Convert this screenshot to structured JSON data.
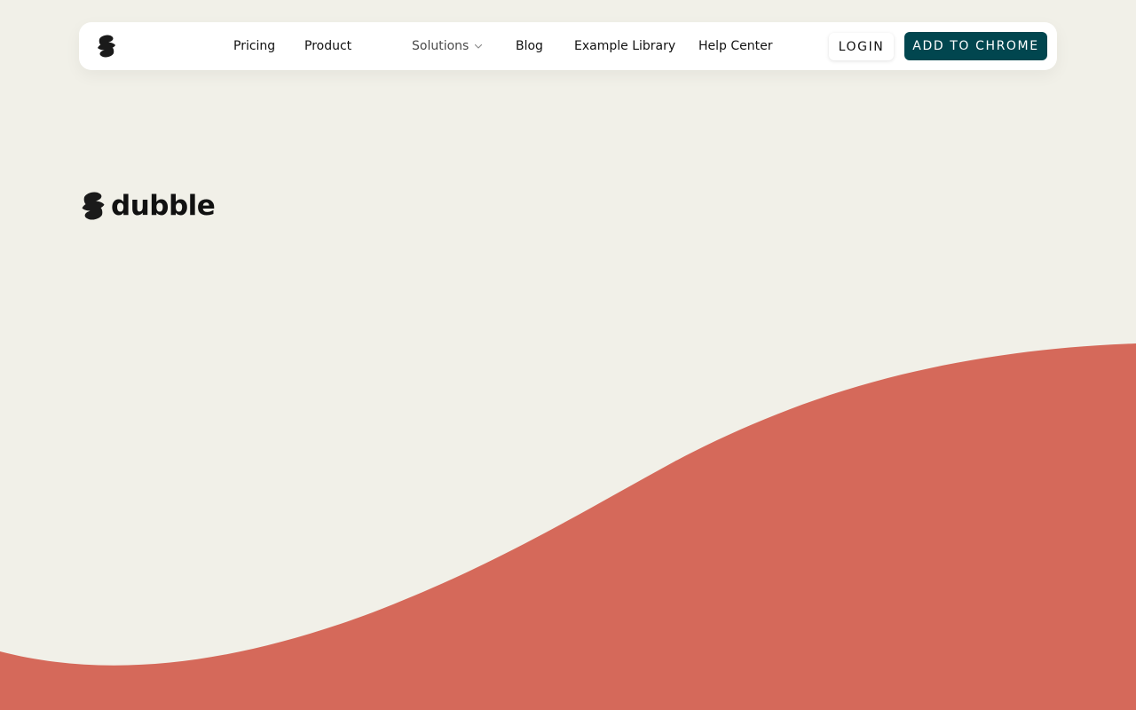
{
  "theme": {
    "background": "#f1f0e8",
    "wave": "#d5695a",
    "primary": "#01464f",
    "logo_color": "#1a1a1a"
  },
  "nav": {
    "logo_icon": "dubble-logo-icon",
    "links": [
      {
        "label": "Pricing"
      },
      {
        "label": "Product"
      },
      {
        "label": "Solutions",
        "has_dropdown": true
      },
      {
        "label": "Blog"
      },
      {
        "label": "Example Library"
      },
      {
        "label": "Help Center"
      }
    ],
    "login_label": "LOGIN",
    "cta_label": "ADD TO CHROME"
  },
  "hero": {
    "brand_name": "dubble"
  }
}
